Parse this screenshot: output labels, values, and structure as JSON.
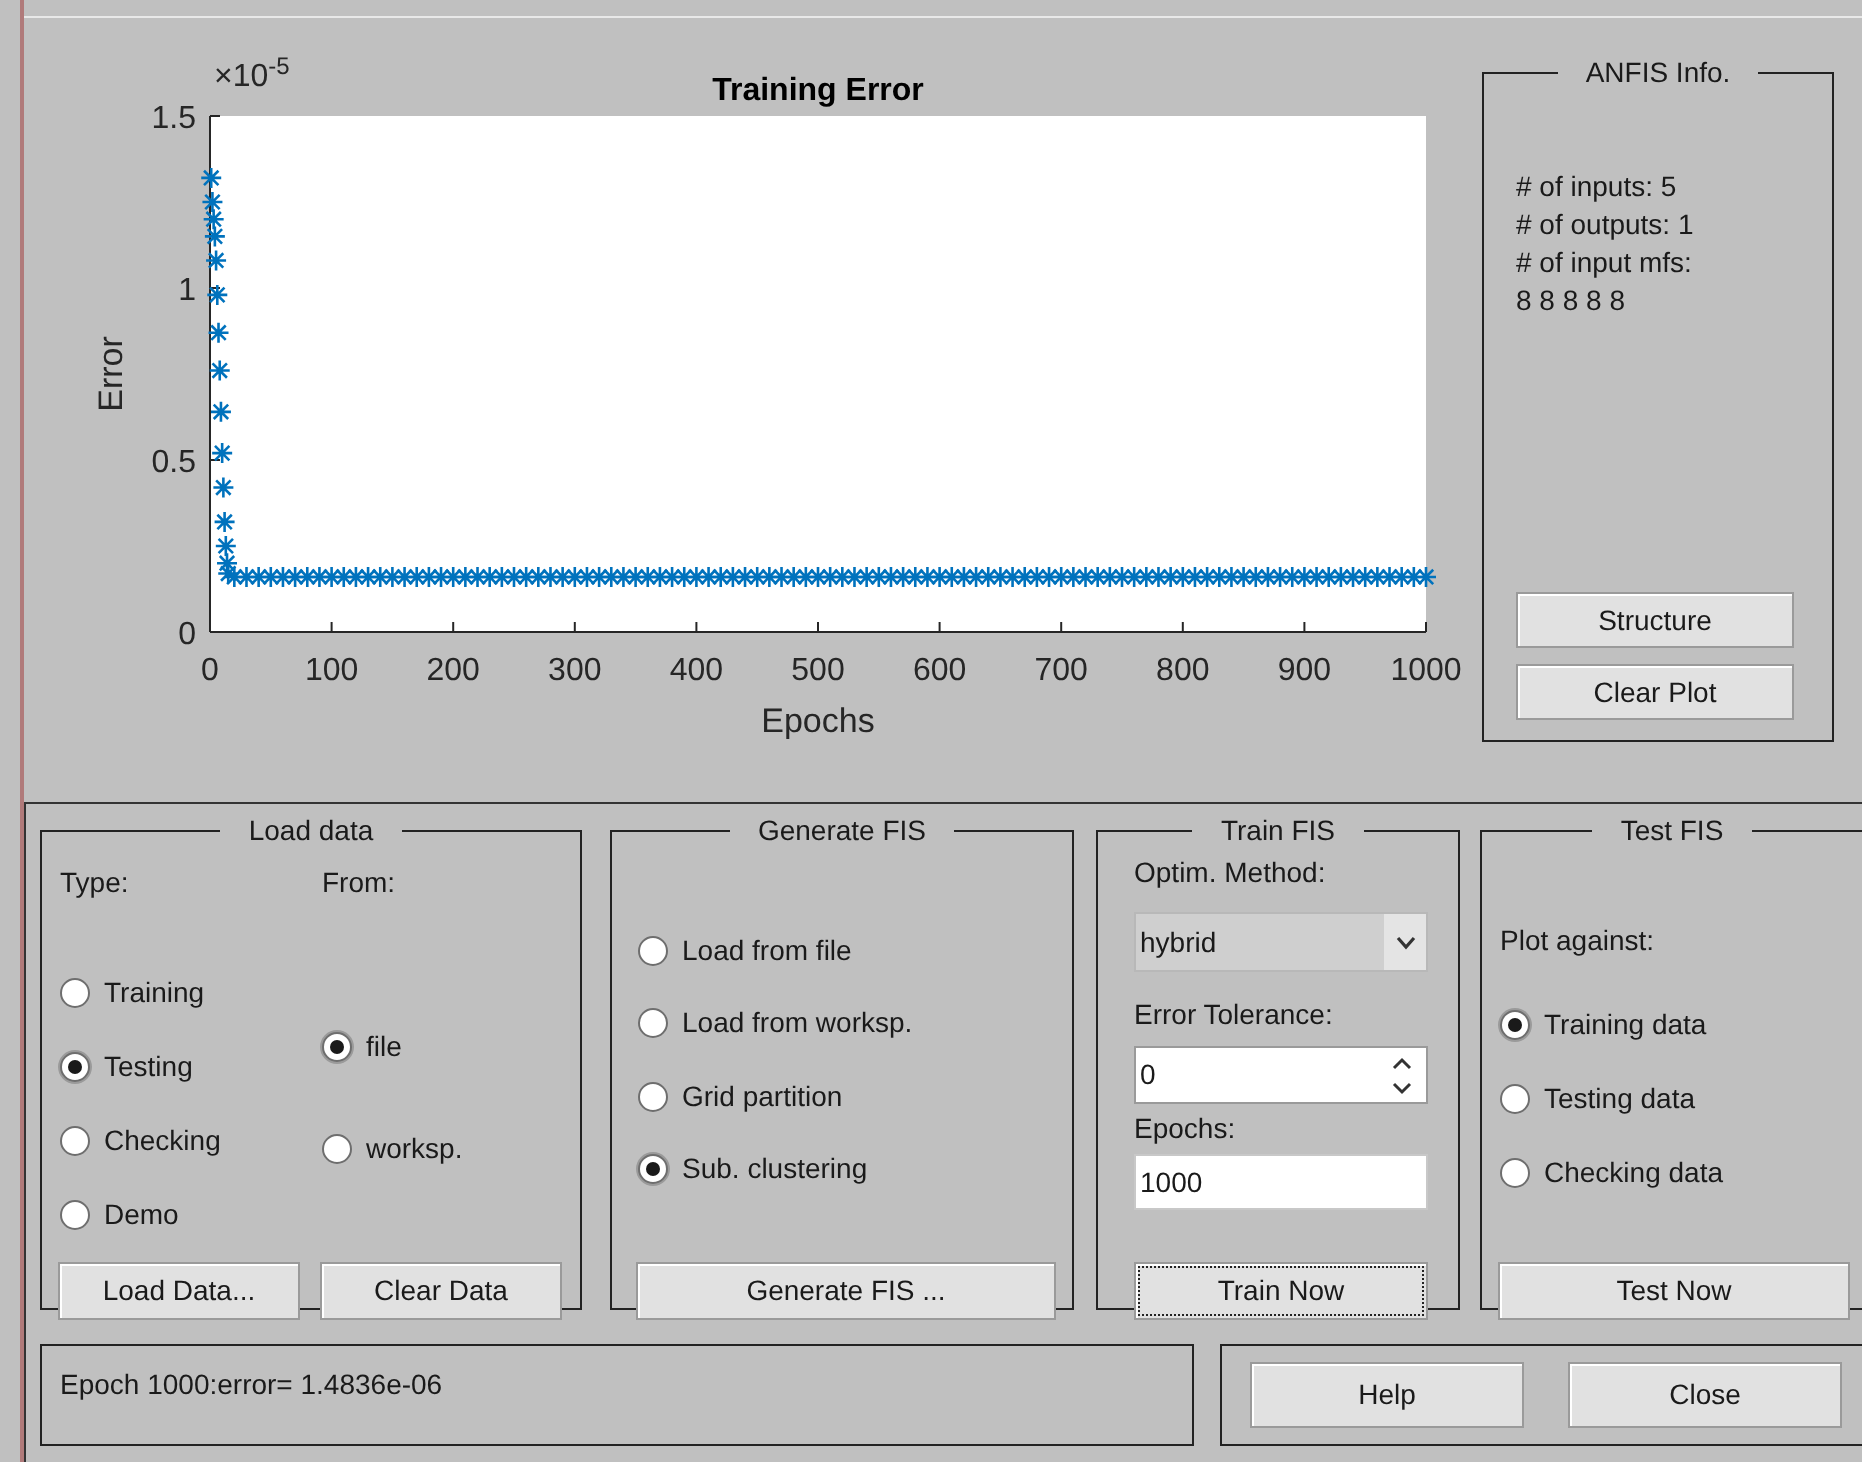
{
  "plot": {
    "chart_data": {
      "type": "scatter",
      "title": "Training Error",
      "xlabel": "Epochs",
      "ylabel": "Error",
      "xlim": [
        0,
        1000
      ],
      "ylim": [
        0,
        1.5
      ],
      "xticks": [
        0,
        100,
        200,
        300,
        400,
        500,
        600,
        700,
        800,
        900,
        1000
      ],
      "yticks": [
        0,
        0.5,
        1,
        1.5
      ],
      "annotations": [
        "×10$^{-5}$"
      ],
      "x": [
        1,
        2,
        3,
        4,
        5,
        6,
        7,
        8,
        9,
        10,
        11,
        12,
        13,
        14,
        15,
        20,
        30,
        40,
        50,
        60,
        70,
        80,
        90,
        100,
        110,
        120,
        130,
        140,
        150,
        160,
        170,
        180,
        190,
        200,
        210,
        220,
        230,
        240,
        250,
        260,
        270,
        280,
        290,
        300,
        310,
        320,
        330,
        340,
        350,
        360,
        370,
        380,
        390,
        400,
        410,
        420,
        430,
        440,
        450,
        460,
        470,
        480,
        490,
        500,
        510,
        520,
        530,
        540,
        550,
        560,
        570,
        580,
        590,
        600,
        610,
        620,
        630,
        640,
        650,
        660,
        670,
        680,
        690,
        700,
        710,
        720,
        730,
        740,
        750,
        760,
        770,
        780,
        790,
        800,
        810,
        820,
        830,
        840,
        850,
        860,
        870,
        880,
        890,
        900,
        910,
        920,
        930,
        940,
        950,
        960,
        970,
        980,
        990,
        1000
      ],
      "series": [
        {
          "color": "#0072bd",
          "values": [
            1.32,
            1.25,
            1.2,
            1.15,
            1.08,
            0.98,
            0.87,
            0.76,
            0.64,
            0.52,
            0.42,
            0.32,
            0.25,
            0.2,
            0.17,
            0.16,
            0.16,
            0.16,
            0.16,
            0.16,
            0.16,
            0.16,
            0.16,
            0.16,
            0.16,
            0.16,
            0.16,
            0.16,
            0.16,
            0.16,
            0.16,
            0.16,
            0.16,
            0.16,
            0.16,
            0.16,
            0.16,
            0.16,
            0.16,
            0.16,
            0.16,
            0.16,
            0.16,
            0.16,
            0.16,
            0.16,
            0.16,
            0.16,
            0.16,
            0.16,
            0.16,
            0.16,
            0.16,
            0.16,
            0.16,
            0.16,
            0.16,
            0.16,
            0.16,
            0.16,
            0.16,
            0.16,
            0.16,
            0.16,
            0.16,
            0.16,
            0.16,
            0.16,
            0.16,
            0.16,
            0.16,
            0.16,
            0.16,
            0.16,
            0.16,
            0.16,
            0.16,
            0.16,
            0.16,
            0.16,
            0.16,
            0.16,
            0.16,
            0.16,
            0.16,
            0.16,
            0.16,
            0.16,
            0.16,
            0.16,
            0.16,
            0.16,
            0.16,
            0.16,
            0.16,
            0.16,
            0.16,
            0.16,
            0.16,
            0.16,
            0.16,
            0.16,
            0.16,
            0.16,
            0.16,
            0.16,
            0.16,
            0.16,
            0.16,
            0.16,
            0.16,
            0.16,
            0.16,
            0.16
          ]
        }
      ]
    }
  },
  "anfis_info": {
    "title": "ANFIS Info.",
    "lines": [
      "# of inputs: 5",
      "# of outputs: 1",
      "# of input mfs:",
      "8 8 8 8 8"
    ],
    "buttons": [
      "Structure",
      "Clear Plot"
    ]
  },
  "load_data": {
    "title": "Load data",
    "type_label": "Type:",
    "from_label": "From:",
    "type_options": [
      {
        "label": "Training",
        "selected": false
      },
      {
        "label": "Testing",
        "selected": true
      },
      {
        "label": "Checking",
        "selected": false
      },
      {
        "label": "Demo",
        "selected": false
      }
    ],
    "from_options": [
      {
        "label": "file",
        "selected": true
      },
      {
        "label": "worksp.",
        "selected": false
      }
    ],
    "buttons": [
      "Load Data...",
      "Clear Data"
    ]
  },
  "generate_fis": {
    "title": "Generate FIS",
    "options": [
      {
        "label": "Load from file",
        "selected": false
      },
      {
        "label": "Load from worksp.",
        "selected": false
      },
      {
        "label": "Grid partition",
        "selected": false
      },
      {
        "label": "Sub. clustering",
        "selected": true
      }
    ],
    "button": "Generate FIS ..."
  },
  "train_fis": {
    "title": "Train FIS",
    "method_label": "Optim. Method:",
    "method": "hybrid",
    "tolerance_label": "Error Tolerance:",
    "tolerance": "0",
    "epochs_label": "Epochs:",
    "epochs": "1000",
    "button": "Train Now",
    "button_focused": true
  },
  "test_fis": {
    "title": "Test FIS",
    "plot_against_label": "Plot against:",
    "options": [
      {
        "label": "Training data",
        "selected": true
      },
      {
        "label": "Testing data",
        "selected": false
      },
      {
        "label": "Checking data",
        "selected": false
      }
    ],
    "button": "Test Now"
  },
  "status": "Epoch 1000:error= 1.4836e-06",
  "dialog_buttons": [
    "Help",
    "Close"
  ]
}
